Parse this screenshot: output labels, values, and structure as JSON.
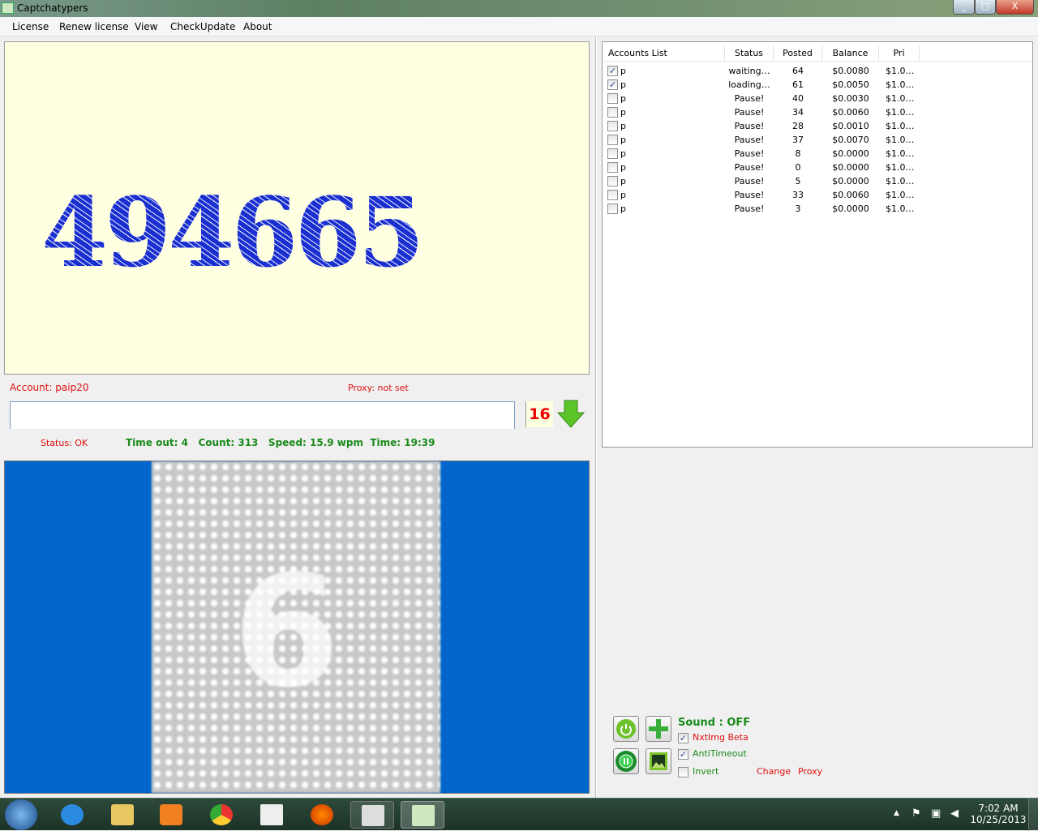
{
  "window": {
    "title": "Captchatypers",
    "min": "_",
    "max": "□",
    "close": "X"
  },
  "menu": [
    "License",
    "Renew license",
    "View",
    "CheckUpdate",
    "About"
  ],
  "captcha": {
    "text": "494665"
  },
  "info": {
    "account": "Account: paip20",
    "proxy": "Proxy: not set",
    "counter": "16",
    "status": "Status: OK",
    "stats": "Time out: 4   Count: 313   Speed: 15.9 wpm  Time: 19:39"
  },
  "answer_input": {
    "value": "",
    "placeholder": ""
  },
  "preview": {
    "digit": "6"
  },
  "accounts": {
    "columns": [
      "Accounts List",
      "Status",
      "Posted",
      "Balance",
      "Pri"
    ],
    "rows": [
      {
        "checked": true,
        "name": "p",
        "status": "waiting…",
        "posted": "64",
        "balance": "$0.0080",
        "pri": "$1.0…"
      },
      {
        "checked": true,
        "name": "p",
        "status": "loading…",
        "posted": "61",
        "balance": "$0.0050",
        "pri": "$1.0…"
      },
      {
        "checked": false,
        "name": "p",
        "status": "Pause!",
        "posted": "40",
        "balance": "$0.0030",
        "pri": "$1.0…"
      },
      {
        "checked": false,
        "name": "p",
        "status": "Pause!",
        "posted": "34",
        "balance": "$0.0060",
        "pri": "$1.0…"
      },
      {
        "checked": false,
        "name": "p",
        "status": "Pause!",
        "posted": "28",
        "balance": "$0.0010",
        "pri": "$1.0…"
      },
      {
        "checked": false,
        "name": "p",
        "status": "Pause!",
        "posted": "37",
        "balance": "$0.0070",
        "pri": "$1.0…"
      },
      {
        "checked": false,
        "name": "p",
        "status": "Pause!",
        "posted": "8",
        "balance": "$0.0000",
        "pri": "$1.0…"
      },
      {
        "checked": false,
        "name": "p",
        "status": "Pause!",
        "posted": "0",
        "balance": "$0.0000",
        "pri": "$1.0…"
      },
      {
        "checked": false,
        "name": "p",
        "status": "Pause!",
        "posted": "5",
        "balance": "$0.0000",
        "pri": "$1.0…"
      },
      {
        "checked": false,
        "name": "p",
        "status": "Pause!",
        "posted": "33",
        "balance": "$0.0060",
        "pri": "$1.0…"
      },
      {
        "checked": false,
        "name": "p",
        "status": "Pause!",
        "posted": "3",
        "balance": "$0.0000",
        "pri": "$1.0…"
      }
    ]
  },
  "controls": {
    "sound": "Sound : OFF",
    "nxtimg": "NxtImg Beta",
    "nxtimg_checked": true,
    "antitimeout": "AntiTimeout",
    "antitimeout_checked": true,
    "invert": "Invert",
    "invert_checked": false,
    "change": "Change",
    "proxy": "Proxy"
  },
  "taskbar": {
    "time": "7:02 AM",
    "date": "10/25/2013"
  }
}
